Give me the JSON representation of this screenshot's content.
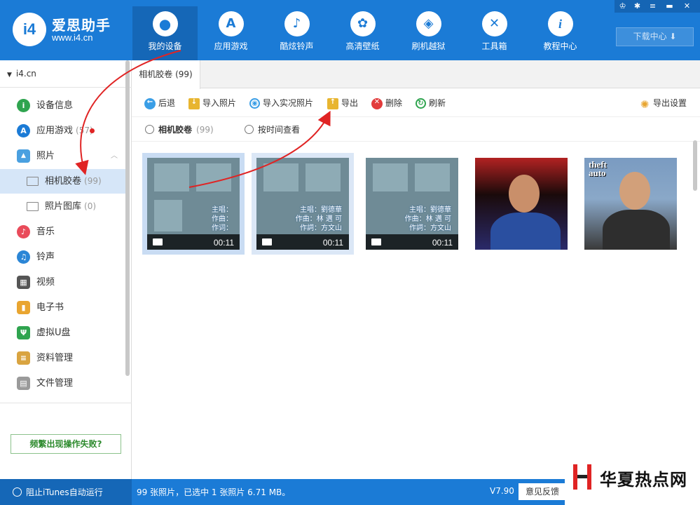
{
  "app": {
    "logo_badge": "i4",
    "title": "爱思助手",
    "url": "www.i4.cn"
  },
  "nav": [
    {
      "label": "我的设备",
      "icon": "apple-icon",
      "glyph": "",
      "active": true
    },
    {
      "label": "应用游戏",
      "icon": "app-store-icon",
      "glyph": "A"
    },
    {
      "label": "酷炫铃声",
      "icon": "bell-icon",
      "glyph": "♪"
    },
    {
      "label": "高清壁纸",
      "icon": "flower-icon",
      "glyph": "✿"
    },
    {
      "label": "刷机越狱",
      "icon": "dropbox-icon",
      "glyph": "◈"
    },
    {
      "label": "工具箱",
      "icon": "tools-icon",
      "glyph": "✕"
    },
    {
      "label": "教程中心",
      "icon": "info-icon",
      "glyph": "i"
    }
  ],
  "window": {
    "buttons": [
      "shirt-icon",
      "gear-icon",
      "menu-icon",
      "minimize-icon",
      "close-icon"
    ],
    "download_label": "下载中心 ⬇"
  },
  "sidebar": {
    "device": "i4.cn",
    "items": [
      {
        "label": "设备信息",
        "icon": "info-icon",
        "color": "#2fa44f",
        "glyph": "i"
      },
      {
        "label": "应用游戏",
        "count": "(57)",
        "icon": "app-store-icon",
        "color": "#1b7bd6",
        "glyph": "A"
      },
      {
        "label": "照片",
        "icon": "photo-icon",
        "color": "#4aa0e0",
        "glyph": "▲"
      },
      {
        "label": "相机胶卷",
        "count": "(99)",
        "icon": "folder-icon",
        "sub": true,
        "selected": true
      },
      {
        "label": "照片图库",
        "count": "(0)",
        "icon": "folder-icon",
        "sub": true
      },
      {
        "label": "音乐",
        "icon": "music-icon",
        "color": "#e94b5a",
        "glyph": "♪"
      },
      {
        "label": "铃声",
        "icon": "bell-icon",
        "color": "#2b86d6",
        "glyph": "♫"
      },
      {
        "label": "视频",
        "icon": "film-icon",
        "color": "#555555",
        "glyph": "▦"
      },
      {
        "label": "电子书",
        "icon": "book-icon",
        "color": "#e9a530",
        "glyph": "▮"
      },
      {
        "label": "虚拟U盘",
        "icon": "usb-icon",
        "color": "#2fa44f",
        "glyph": "Ψ"
      },
      {
        "label": "资料管理",
        "icon": "contacts-icon",
        "color": "#d9a441",
        "glyph": "≡"
      },
      {
        "label": "文件管理",
        "icon": "file-icon",
        "color": "#9a9a9a",
        "glyph": "▤"
      }
    ],
    "help_label": "频繁出现操作失败?"
  },
  "main": {
    "tab_label": "相机胶卷 (99)",
    "toolbar": {
      "back": "后退",
      "import_photos": "导入照片",
      "import_live": "导入实况照片",
      "export": "导出",
      "delete": "删除",
      "refresh": "刷新",
      "export_settings": "导出设置"
    },
    "filter": {
      "camera_roll": "相机胶卷",
      "camera_roll_count": "(99)",
      "by_time": "按时间查看"
    },
    "thumbnails": [
      {
        "kind": "video",
        "duration": "00:11",
        "lyrics": [
          "主唱：",
          "作曲：",
          "作词："
        ],
        "state": "selected"
      },
      {
        "kind": "video",
        "duration": "00:11",
        "lyrics": [
          "主唱：劉德華",
          "作曲：林 邁 可",
          "作詞：方文山"
        ],
        "state": "hover"
      },
      {
        "kind": "video",
        "duration": "00:11",
        "lyrics": [
          "主唱：劉德華",
          "作曲：林 邁 可",
          "作詞：方文山"
        ],
        "state": "normal"
      },
      {
        "kind": "photo",
        "state": "normal"
      },
      {
        "kind": "photo",
        "overlay_text": [
          "theft",
          "auto"
        ],
        "state": "normal"
      }
    ]
  },
  "status": {
    "itunes_label": "阻止iTunes自动运行",
    "summary": "99 张照片，已选中 1 张照片 6.71 MB。",
    "version": "V7.90",
    "feedback": "意见反馈"
  },
  "watermark": {
    "text": "华夏热点网"
  }
}
